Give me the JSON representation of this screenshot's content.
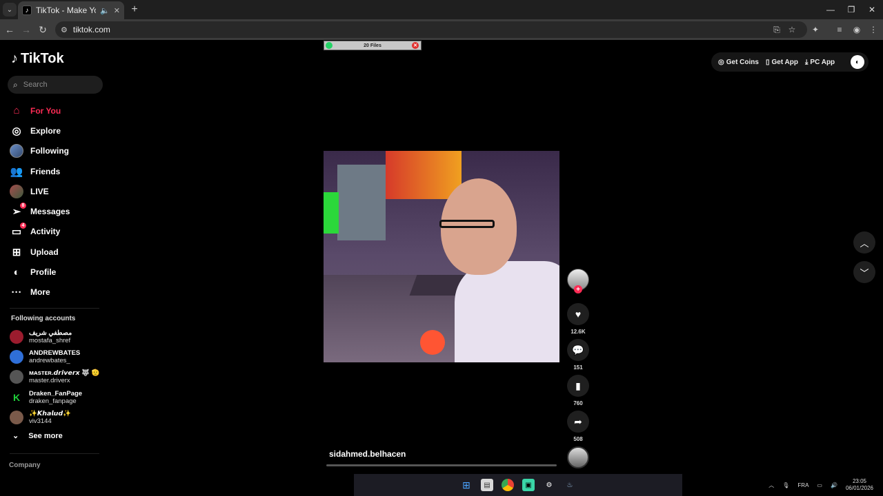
{
  "browser": {
    "tab_title": "TikTok - Make Your Day",
    "url": "tiktok.com",
    "tab_mute_icon": "speaker-icon",
    "tab_close": "✕",
    "new_tab": "+",
    "minimize": "—",
    "restore": "❐",
    "close": "✕"
  },
  "sidebar": {
    "logo": "TikTok",
    "search_placeholder": "Search",
    "nav": [
      {
        "label": "For You",
        "icon": "home-icon",
        "active": true
      },
      {
        "label": "Explore",
        "icon": "compass-icon"
      },
      {
        "label": "Following",
        "icon": "following-avatar-icon"
      },
      {
        "label": "Friends",
        "icon": "friends-icon"
      },
      {
        "label": "LIVE",
        "icon": "live-avatar-icon"
      },
      {
        "label": "Messages",
        "icon": "messages-icon",
        "badge": "8"
      },
      {
        "label": "Activity",
        "icon": "activity-icon",
        "badge": "4"
      },
      {
        "label": "Upload",
        "icon": "upload-icon"
      },
      {
        "label": "Profile",
        "icon": "profile-icon"
      },
      {
        "label": "More",
        "icon": "more-icon"
      }
    ],
    "following_title": "Following accounts",
    "following": [
      {
        "display": "مصطفي شريف",
        "user": "mostafa_shref",
        "color": "#9b1c2e"
      },
      {
        "display": "ANDREWBATES",
        "user": "andrewbates_",
        "color": "#2f6fd8"
      },
      {
        "display": "ᴍᴀsᴛᴇʀ.𝙙𝙧𝙞𝙫𝙚𝙧𝙭 🐺 🫡",
        "user": "master.driverx",
        "color": "#555555"
      },
      {
        "display": "Draken_FanPage",
        "user": "draken_fanpage",
        "color": "#1fcf3a"
      },
      {
        "display": "✨𝙆𝙝𝙖𝙡𝙪𝙙✨",
        "user": "viv3144",
        "color": "#7a5a4a"
      }
    ],
    "see_more": "See more",
    "company": "Company"
  },
  "header": {
    "get_coins": "Get Coins",
    "get_app": "Get App",
    "pc_app": "PC App"
  },
  "files_widget": {
    "label": "20 Files"
  },
  "video": {
    "author": "sidahmed.belhacen",
    "likes": "12.6K",
    "comments": "151",
    "saves": "760",
    "shares": "508"
  },
  "tray": {
    "lang": "FRA",
    "time": "23:05",
    "date": "06/01/2026"
  }
}
